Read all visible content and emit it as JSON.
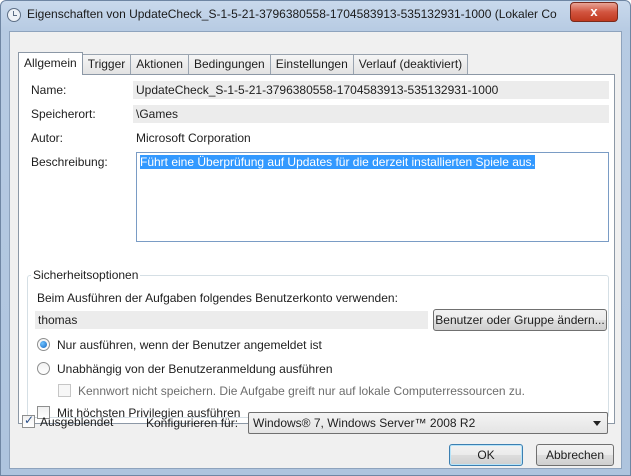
{
  "window": {
    "title": "Eigenschaften von UpdateCheck_S-1-5-21-3796380558-1704583913-535132931-1000 (Lokaler Comput...",
    "close_label": "x"
  },
  "tabs": [
    {
      "label": "Allgemein",
      "active": true
    },
    {
      "label": "Trigger"
    },
    {
      "label": "Aktionen"
    },
    {
      "label": "Bedingungen"
    },
    {
      "label": "Einstellungen"
    },
    {
      "label": "Verlauf (deaktiviert)"
    }
  ],
  "general": {
    "name_label": "Name:",
    "name_value": "UpdateCheck_S-1-5-21-3796380558-1704583913-535132931-1000",
    "location_label": "Speicherort:",
    "location_value": "\\Games",
    "author_label": "Autor:",
    "author_value": "Microsoft Corporation",
    "description_label": "Beschreibung:",
    "description_value": "Führt eine Überprüfung auf Updates für die derzeit installierten Spiele aus."
  },
  "security": {
    "group_title": "Sicherheitsoptionen",
    "account_prompt": "Beim Ausführen der Aufgaben folgendes Benutzerkonto verwenden:",
    "account_value": "thomas",
    "change_user_button": "Benutzer oder Gruppe ändern...",
    "radio_logged_on": "Nur ausführen, wenn der Benutzer angemeldet ist",
    "radio_independent": "Unabhängig von der Benutzeranmeldung ausführen",
    "no_store_password": "Kennwort nicht speichern. Die Aufgabe greift nur auf lokale Computerressourcen zu.",
    "highest_privileges": "Mit höchsten Privilegien ausführen"
  },
  "footer": {
    "hidden_label": "Ausgeblendet",
    "configure_label": "Konfigurieren für:",
    "configure_value": "Windows® 7, Windows Server™ 2008 R2",
    "ok_button": "OK",
    "cancel_button": "Abbrechen"
  }
}
